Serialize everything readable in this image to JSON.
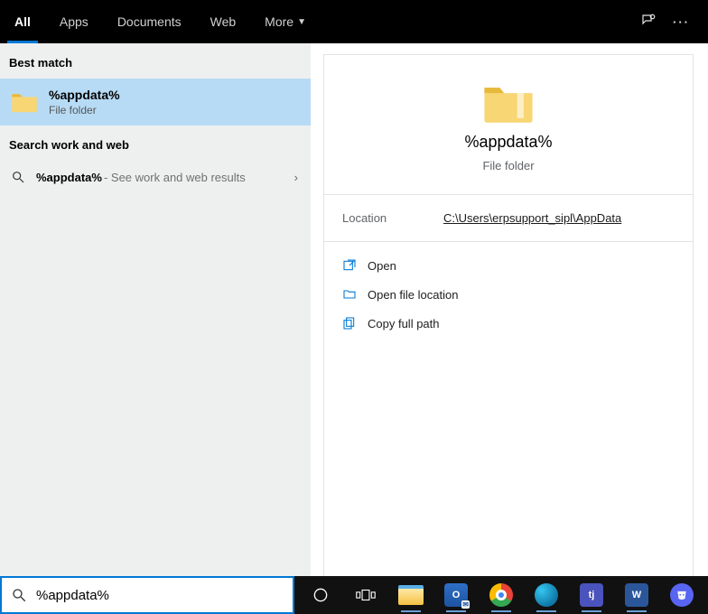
{
  "topbar": {
    "tabs": [
      "All",
      "Apps",
      "Documents",
      "Web",
      "More"
    ],
    "active_index": 0
  },
  "left": {
    "best_match_header": "Best match",
    "best": {
      "title": "%appdata%",
      "subtitle": "File folder"
    },
    "work_web_header": "Search work and web",
    "web_result": {
      "query": "%appdata%",
      "suffix": " - See work and web results"
    }
  },
  "preview": {
    "name": "%appdata%",
    "type": "File folder",
    "location_label": "Location",
    "location_value": "C:\\Users\\erpsupport_sipl\\AppData",
    "actions": {
      "open": "Open",
      "open_location": "Open file location",
      "copy_path": "Copy full path"
    }
  },
  "search": {
    "value": "%appdata%"
  },
  "taskbar": {
    "cortana": "cortana",
    "taskview": "task-view",
    "apps": [
      {
        "id": "file-explorer",
        "label": "Explorer"
      },
      {
        "id": "outlook",
        "label": "O",
        "class": "app-outlook"
      },
      {
        "id": "chrome",
        "label": "",
        "class": "app-chrome"
      },
      {
        "id": "edge",
        "label": "",
        "class": "app-edge"
      },
      {
        "id": "teams",
        "label": "T",
        "class": "app-teams"
      },
      {
        "id": "word",
        "label": "W",
        "class": "app-word"
      },
      {
        "id": "discord",
        "label": "",
        "class": "app-discord"
      }
    ]
  }
}
